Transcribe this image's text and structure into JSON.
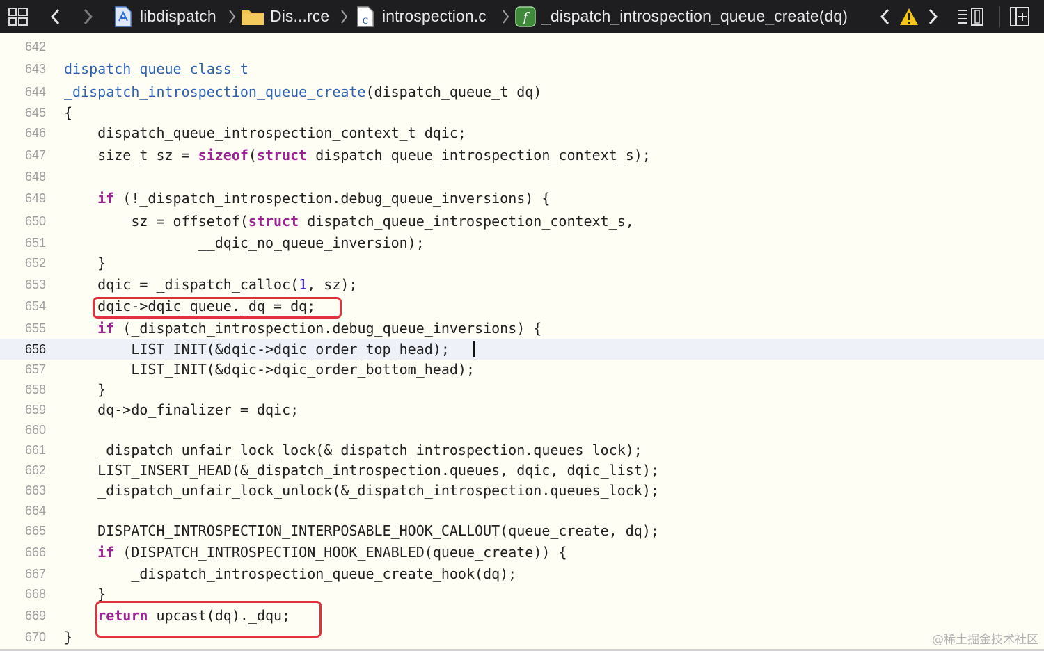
{
  "toolbar": {
    "breadcrumbs": {
      "project": "libdispatch",
      "folder": "Dis...rce",
      "file": "introspection.c",
      "symbol": "_dispatch_introspection_queue_create(dq)"
    },
    "icons": {
      "grid": "related-items-icon",
      "back": "chevron-left-icon",
      "forward": "chevron-right-icon",
      "project": "xcode-project-icon",
      "folder": "folder-icon",
      "file": "c-file-icon",
      "symbol": "function-icon",
      "prev_issue": "chevron-left-icon",
      "warning": "warning-icon",
      "next_issue": "chevron-right-icon",
      "minimap": "editor-options-icon",
      "add_editor": "add-editor-icon"
    },
    "colors": {
      "warning": "#f5c518",
      "function_badge": "#3e8a3a",
      "folder": "#f2c14e"
    }
  },
  "editor": {
    "current_line": "656",
    "lines": [
      {
        "n": "642",
        "code": ""
      },
      {
        "n": "643",
        "code": "dispatch_queue_class_t"
      },
      {
        "n": "644",
        "code": "_dispatch_introspection_queue_create(dispatch_queue_t dq)"
      },
      {
        "n": "645",
        "code": "{"
      },
      {
        "n": "646",
        "code": "    dispatch_queue_introspection_context_t dqic;"
      },
      {
        "n": "647",
        "code": "    size_t sz = sizeof(struct dispatch_queue_introspection_context_s);"
      },
      {
        "n": "648",
        "code": ""
      },
      {
        "n": "649",
        "code": "    if (!_dispatch_introspection.debug_queue_inversions) {"
      },
      {
        "n": "650",
        "code": "        sz = offsetof(struct dispatch_queue_introspection_context_s,"
      },
      {
        "n": "651",
        "code": "                __dqic_no_queue_inversion);"
      },
      {
        "n": "652",
        "code": "    }"
      },
      {
        "n": "653",
        "code": "    dqic = _dispatch_calloc(1, sz);"
      },
      {
        "n": "654",
        "code": "    dqic->dqic_queue._dq = dq;"
      },
      {
        "n": "655",
        "code": "    if (_dispatch_introspection.debug_queue_inversions) {"
      },
      {
        "n": "656",
        "code": "        LIST_INIT(&dqic->dqic_order_top_head);"
      },
      {
        "n": "657",
        "code": "        LIST_INIT(&dqic->dqic_order_bottom_head);"
      },
      {
        "n": "658",
        "code": "    }"
      },
      {
        "n": "659",
        "code": "    dq->do_finalizer = dqic;"
      },
      {
        "n": "660",
        "code": ""
      },
      {
        "n": "661",
        "code": "    _dispatch_unfair_lock_lock(&_dispatch_introspection.queues_lock);"
      },
      {
        "n": "662",
        "code": "    LIST_INSERT_HEAD(&_dispatch_introspection.queues, dqic, dqic_list);"
      },
      {
        "n": "663",
        "code": "    _dispatch_unfair_lock_unlock(&_dispatch_introspection.queues_lock);"
      },
      {
        "n": "664",
        "code": ""
      },
      {
        "n": "665",
        "code": "    DISPATCH_INTROSPECTION_INTERPOSABLE_HOOK_CALLOUT(queue_create, dq);"
      },
      {
        "n": "666",
        "code": "    if (DISPATCH_INTROSPECTION_HOOK_ENABLED(queue_create)) {"
      },
      {
        "n": "667",
        "code": "        _dispatch_introspection_queue_create_hook(dq);"
      },
      {
        "n": "668",
        "code": "    }"
      },
      {
        "n": "669",
        "code": "    return upcast(dq)._dqu;"
      },
      {
        "n": "670",
        "code": "}"
      }
    ],
    "syntax_colors": {
      "function": "#2f62b0",
      "keyword": "#9b2393",
      "number": "#1c00cf",
      "annotation_box": "#e0333d"
    }
  },
  "watermark": "@稀土掘金技术社区"
}
